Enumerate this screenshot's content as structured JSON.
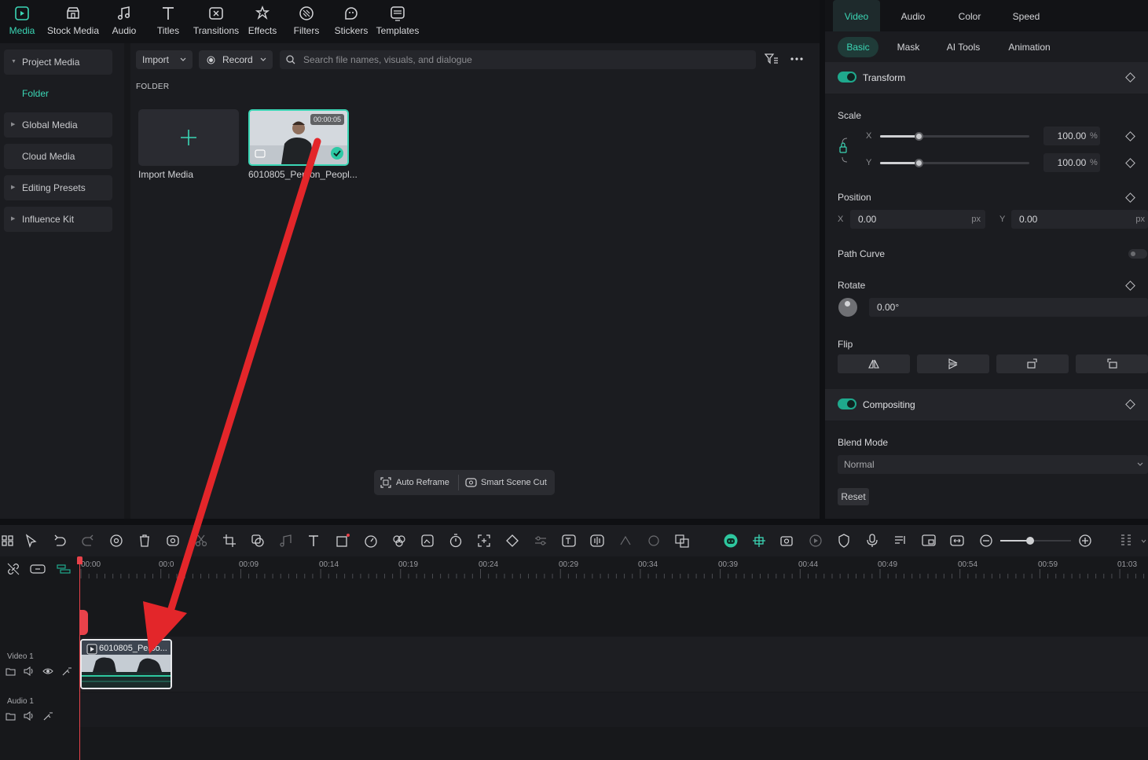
{
  "toolbar": {
    "items": [
      {
        "label": "Media",
        "icon": "media-icon",
        "active": true
      },
      {
        "label": "Stock Media",
        "icon": "stock-media-icon"
      },
      {
        "label": "Audio",
        "icon": "music-note-icon"
      },
      {
        "label": "Titles",
        "icon": "titles-icon"
      },
      {
        "label": "Transitions",
        "icon": "transitions-icon"
      },
      {
        "label": "Effects",
        "icon": "effects-icon"
      },
      {
        "label": "Filters",
        "icon": "filters-icon"
      },
      {
        "label": "Stickers",
        "icon": "stickers-icon"
      },
      {
        "label": "Templates",
        "icon": "templates-icon"
      }
    ]
  },
  "sidebar": {
    "items": [
      {
        "label": "Project Media"
      },
      {
        "label": "Folder"
      },
      {
        "label": "Global Media"
      },
      {
        "label": "Cloud Media"
      },
      {
        "label": "Editing Presets"
      },
      {
        "label": "Influence Kit"
      }
    ]
  },
  "media": {
    "import_label": "Import",
    "record_label": "Record",
    "search_placeholder": "Search file names, visuals, and dialogue",
    "folder_heading": "FOLDER",
    "import_card_label": "Import Media",
    "clip_name": "6010805_Person_Peopl...",
    "clip_duration": "00:00:05",
    "auto_reframe_label": "Auto Reframe",
    "smart_scene_cut_label": "Smart Scene Cut"
  },
  "props": {
    "tabs": [
      "Video",
      "Audio",
      "Color",
      "Speed"
    ],
    "subtabs": [
      "Basic",
      "Mask",
      "AI Tools",
      "Animation"
    ],
    "transform_title": "Transform",
    "scale_label": "Scale",
    "scale_x_axis": "X",
    "scale_y_axis": "Y",
    "scale_x": "100.00",
    "scale_y": "100.00",
    "percent_unit": "%",
    "position_label": "Position",
    "pos_x_axis": "X",
    "pos_y_axis": "Y",
    "pos_x": "0.00",
    "pos_y": "0.00",
    "px_unit": "px",
    "path_curve_label": "Path Curve",
    "rotate_label": "Rotate",
    "rotate_value": "0.00°",
    "flip_label": "Flip",
    "compositing_title": "Compositing",
    "blend_mode_label": "Blend Mode",
    "blend_mode_value": "Normal",
    "reset_label": "Reset",
    "accent_color": "#3bd6b5"
  },
  "timeline": {
    "ruler_labels": [
      "00:00",
      "00:0",
      "00:09",
      "00:14",
      "00:19",
      "00:24",
      "00:29",
      "00:34",
      "00:39",
      "00:44",
      "00:49",
      "00:54",
      "00:59",
      "01:03"
    ],
    "video_track_label": "Video 1",
    "audio_track_label": "Audio 1",
    "clip_label": "6010805_Perso...",
    "playhead_color": "#e8424a"
  }
}
